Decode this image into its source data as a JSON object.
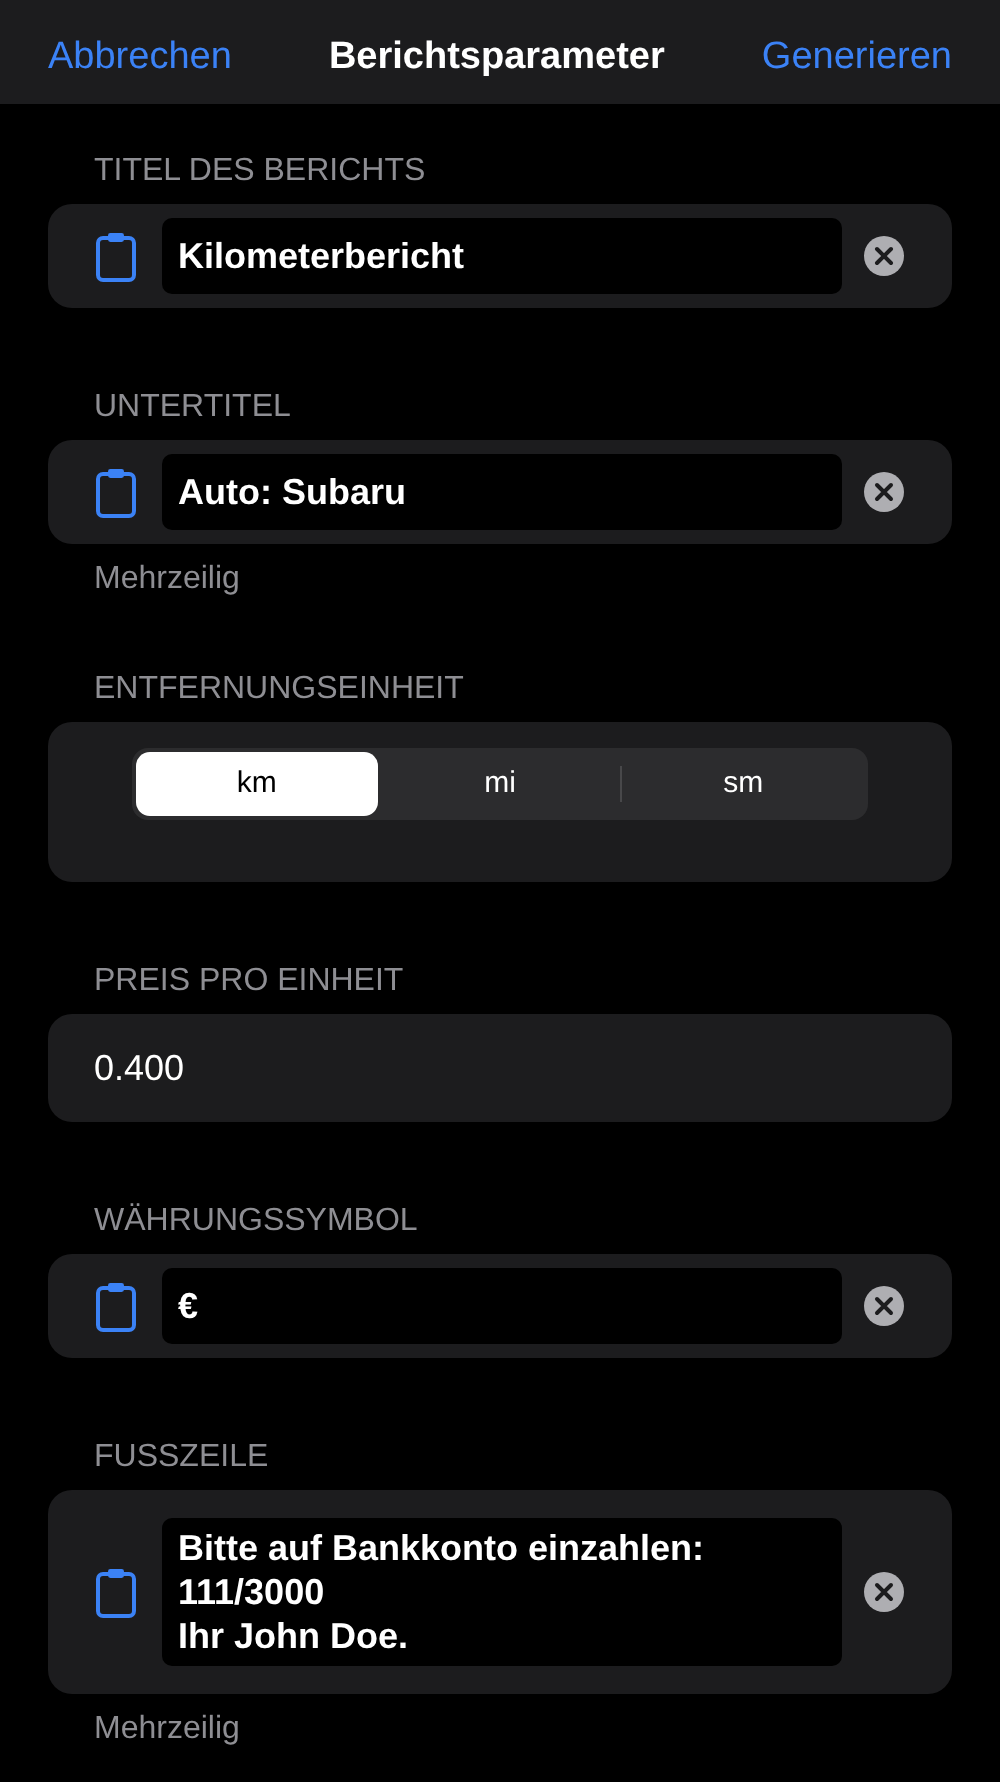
{
  "nav": {
    "cancel": "Abbrechen",
    "title": "Berichtsparameter",
    "confirm": "Generieren"
  },
  "sections": [
    {
      "kind": "text-field",
      "header": "TITEL DES BERICHTS",
      "value": "Kilometerbericht"
    },
    {
      "kind": "text-field",
      "header": "UNTERTITEL",
      "value": "Auto: Subaru",
      "footnote": "Mehrzeilig"
    },
    {
      "kind": "segmented",
      "header": "ENTFERNUNGSEINHEIT",
      "segments": [
        {
          "label": "km",
          "selected": true
        },
        {
          "label": "mi",
          "selected": false
        },
        {
          "label": "sm",
          "selected": false
        }
      ]
    },
    {
      "kind": "plain-value",
      "header": "PREIS PRO EINHEIT",
      "value": "0.400"
    },
    {
      "kind": "text-field",
      "header": "WÄHRUNGSSYMBOL",
      "value": "€"
    },
    {
      "kind": "text-area",
      "header": "FUSSZEILE",
      "lines": [
        "Bitte auf Bankkonto einzahlen:",
        "111/3000",
        "Ihr John Doe."
      ],
      "footnote": "Mehrzeilig"
    }
  ]
}
